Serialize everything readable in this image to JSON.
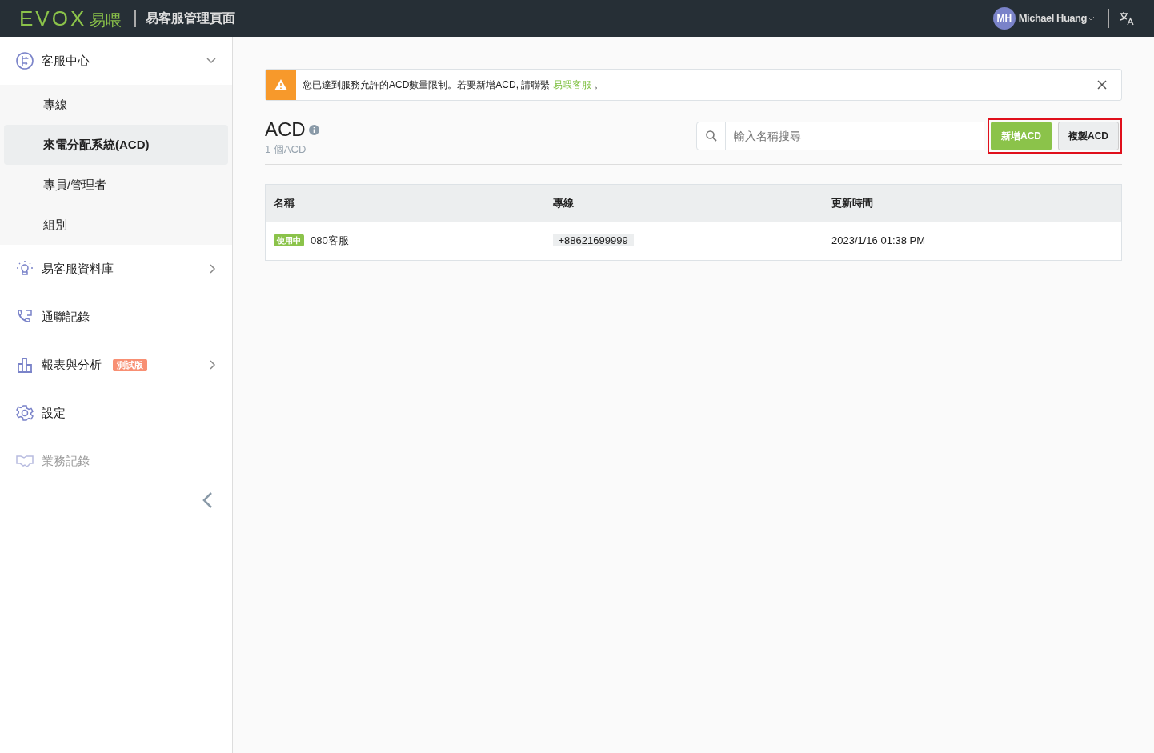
{
  "header": {
    "logo": "EVOX",
    "logo_cn": "易喂",
    "title": "易客服管理頁面",
    "user": {
      "initials": "MH",
      "name": "Michael Huang"
    }
  },
  "sidebar": {
    "items": [
      {
        "label": "客服中心",
        "expanded": true,
        "children": [
          {
            "label": "專線",
            "selected": false
          },
          {
            "label": "來電分配系統(ACD)",
            "selected": true
          },
          {
            "label": "專員/管理者",
            "selected": false
          },
          {
            "label": "組別",
            "selected": false
          }
        ]
      },
      {
        "label": "易客服資料庫",
        "expanded": false,
        "disabled": false
      },
      {
        "label": "通聯記錄",
        "disabled": false
      },
      {
        "label": "報表與分析",
        "expanded": false,
        "badge": "測試版",
        "disabled": false
      },
      {
        "label": "設定",
        "disabled": false
      },
      {
        "label": "業務記錄",
        "disabled": true
      }
    ]
  },
  "alert": {
    "before": "您已達到服務允許的ACD數量限制。若要新增ACD, 請聯繫 ",
    "link": "易喂客服",
    "after": " 。"
  },
  "page": {
    "title": "ACD",
    "count": "1 個ACD"
  },
  "search": {
    "placeholder": "輸入名稱搜尋"
  },
  "actions": {
    "highlighted": true,
    "buttons": [
      {
        "label": "新增ACD",
        "kind": "primary"
      },
      {
        "label": "複製ACD",
        "kind": "secondary"
      }
    ]
  },
  "table": {
    "columns": [
      "名稱",
      "專線",
      "更新時間"
    ],
    "rows": [
      {
        "status": "使用中",
        "name": "080客服",
        "line": "+88621699999",
        "updated": "2023/1/16 01:38 PM"
      }
    ]
  }
}
